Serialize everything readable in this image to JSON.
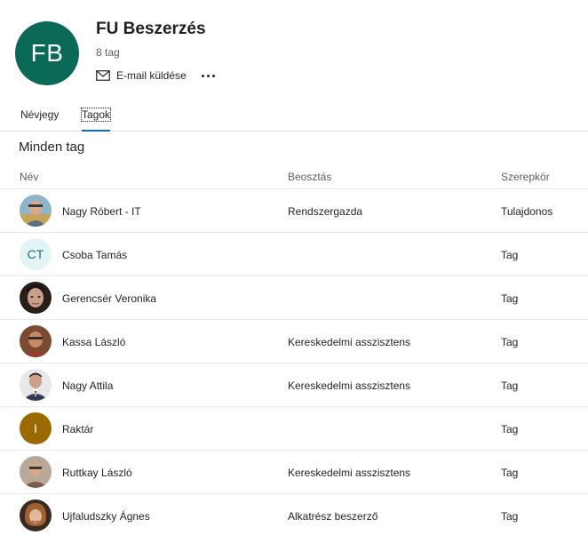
{
  "group": {
    "initials": "FB",
    "name": "FU Beszerzés",
    "member_count": "8 tag",
    "email_label": "E-mail küldése",
    "avatar_color": "#0b6a57"
  },
  "tabs": [
    {
      "label": "Névjegy",
      "active": false
    },
    {
      "label": "Tagok",
      "active": true
    }
  ],
  "section_title": "Minden tag",
  "columns": {
    "name": "Név",
    "title": "Beosztás",
    "role": "Szerepkör"
  },
  "members": [
    {
      "name": "Nagy Róbert - IT",
      "title": "Rendszergazda",
      "role": "Tulajdonos",
      "avatar": "photo"
    },
    {
      "name": "Csoba Tamás",
      "title": "",
      "role": "Tag",
      "avatar": "initials",
      "initials": "CT"
    },
    {
      "name": "Gerencsér Veronika",
      "title": "",
      "role": "Tag",
      "avatar": "photo"
    },
    {
      "name": "Kassa László",
      "title": "Kereskedelmi asszisztens",
      "role": "Tag",
      "avatar": "photo"
    },
    {
      "name": "Nagy Attila",
      "title": "Kereskedelmi asszisztens",
      "role": "Tag",
      "avatar": "photo"
    },
    {
      "name": "Raktár",
      "title": "",
      "role": "Tag",
      "avatar": "initials",
      "initials": "I"
    },
    {
      "name": "Ruttkay László",
      "title": "Kereskedelmi asszisztens",
      "role": "Tag",
      "avatar": "photo"
    },
    {
      "name": "Ujfaludszky Ágnes",
      "title": "Alkatrész beszerző",
      "role": "Tag",
      "avatar": "photo"
    }
  ],
  "colors": {
    "accent": "#0f6cbd",
    "ct_avatar_bg": "#e3f4f6",
    "ct_avatar_fg": "#1d6e7a",
    "raktar_avatar_bg": "#9a6a00"
  }
}
